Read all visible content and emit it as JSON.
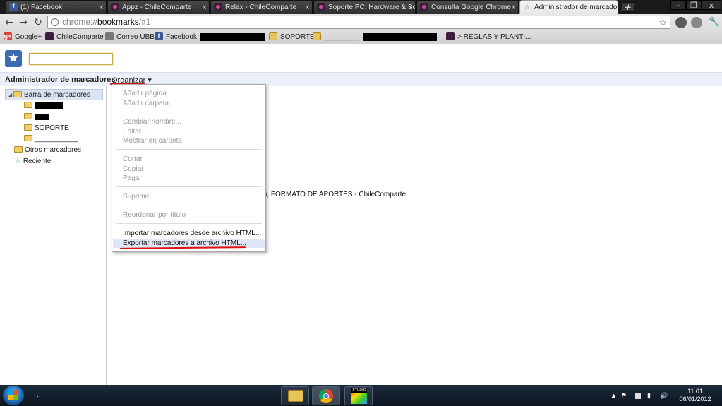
{
  "tabs": [
    {
      "label": "(1) Facebook",
      "favicon": "f"
    },
    {
      "label": "Appz - ChileComparte",
      "favicon": ""
    },
    {
      "label": "Relax - ChileComparte",
      "favicon": ""
    },
    {
      "label": "Soporte PC: Hardware & So",
      "favicon": ""
    },
    {
      "label": "Consulta Google Chrome",
      "favicon": ""
    },
    {
      "label": "Administrador de marcador",
      "favicon": "☆"
    }
  ],
  "window_controls": {
    "minimize": "–",
    "restore": "❐",
    "close": "x",
    "newtab": "+"
  },
  "toolbar": {
    "back": "←",
    "forward": "→",
    "reload": "↻",
    "url_scheme": "chrome://",
    "url_host": "bookmarks",
    "url_path": "/#1",
    "star": "☆",
    "wrench": "🔧"
  },
  "bookmarks_bar": {
    "items": [
      {
        "label": "Google+",
        "icon": "g+"
      },
      {
        "label": "ChileComparte",
        "icon": ""
      },
      {
        "label": "Correo UBB",
        "icon": ""
      },
      {
        "label": "Facebook",
        "icon": "f"
      },
      {
        "label": "SOPORTE",
        "icon": ""
      },
      {
        "label": "_________",
        "icon": ""
      },
      {
        "label": "> REGLAS Y PLANTI...",
        "icon": ""
      }
    ]
  },
  "manager": {
    "logo": "★",
    "search_value": "",
    "title": "Administrador de marcadores",
    "organize": "Organizar ▾"
  },
  "tree": {
    "toggle": "◢",
    "bookmarks_bar": "Barra de marcadores",
    "soporte": "SOPORTE",
    "underscore_folder": "___________",
    "other": "Otros marcadores",
    "recent": "Reciente",
    "recent_icon": "☆"
  },
  "list": {
    "visible_text": "FAQ), FORMATO DE APORTES - ChileComparte"
  },
  "menu": {
    "items": [
      {
        "label": "Añadir página...",
        "enabled": false
      },
      {
        "label": "Añadir carpeta...",
        "enabled": false
      },
      {
        "label": "Cambiar nombre...",
        "enabled": false
      },
      {
        "label": "Editar...",
        "enabled": false
      },
      {
        "label": "Mostrar en carpeta",
        "enabled": false
      },
      {
        "label": "Cortar",
        "enabled": false
      },
      {
        "label": "Copiar",
        "enabled": false
      },
      {
        "label": "Pegar",
        "enabled": false
      },
      {
        "label": "Suprimir",
        "enabled": false
      },
      {
        "label": "Reordenar por título",
        "enabled": false
      },
      {
        "label": "Importar marcadores desde archivo HTML...",
        "enabled": true
      },
      {
        "label": "Exportar marcadores a archivo HTML...",
        "enabled": true
      }
    ]
  },
  "taskbar": {
    "start_label": "..",
    "studio_label": "STUDIO",
    "time": "11:01",
    "date": "06/01/2012",
    "tray": {
      "up": "▲",
      "flag": "⚑",
      "signal": "▮",
      "volume": "🔊"
    }
  },
  "colors": {
    "accent_red": "#dd1111",
    "selection": "#dce4f4",
    "header_bg": "#ebeff9"
  }
}
